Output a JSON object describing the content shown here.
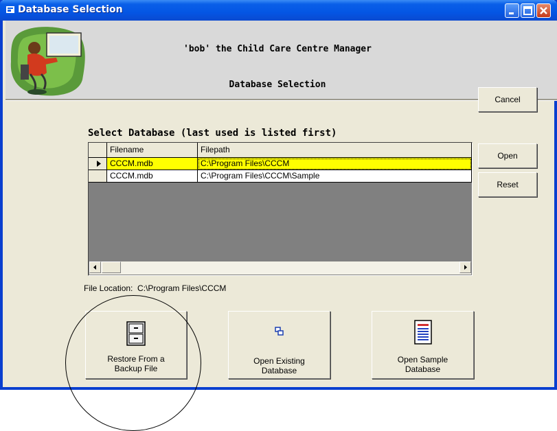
{
  "window": {
    "title": "Database Selection"
  },
  "header": {
    "app_title": "'bob' the Child Care Centre Manager",
    "section_title": "Database Selection"
  },
  "buttons": {
    "cancel": "Cancel",
    "open": "Open",
    "reset": "Reset",
    "restore": [
      "Restore From a",
      "Backup File"
    ],
    "open_existing": [
      "Open  Existing",
      "Database"
    ],
    "open_sample": [
      "Open Sample",
      "Database"
    ]
  },
  "grid": {
    "label": "Select Database (last used is listed first)",
    "columns": [
      "Filename",
      "Filepath"
    ],
    "rows": [
      {
        "filename": "CCCM.mdb",
        "filepath": "C:\\Program Files\\CCCM",
        "selected": true
      },
      {
        "filename": "CCCM.mdb",
        "filepath": "C:\\Program Files\\CCCM\\Sample",
        "selected": false
      }
    ]
  },
  "file_location": {
    "label": "File Location:",
    "value": "C:\\Program Files\\CCCM"
  },
  "colors": {
    "title_bar": "#0a5fe8",
    "selected_row": "#ffff00",
    "window_bg": "#ece9d8"
  },
  "icons": [
    "window-icon",
    "minimize-icon",
    "maximize-icon",
    "close-icon",
    "filing-cabinet-icon",
    "open-db-icon",
    "sample-db-icon",
    "child-at-computer-logo"
  ]
}
